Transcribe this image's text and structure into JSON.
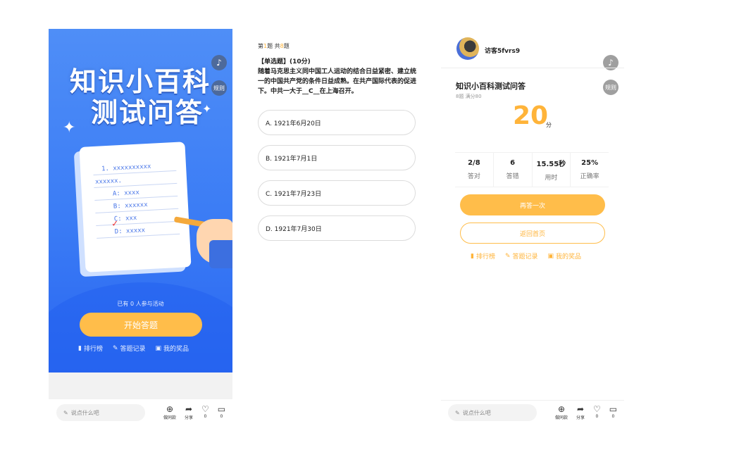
{
  "left": {
    "title_line1": "知识小百科",
    "title_line2": "测试问答",
    "rules_label": "规则",
    "paper_lines": [
      "1.  xxxxxxxxxx",
      "xxxxxx.",
      "A:  xxxx",
      "B:  xxxxxx",
      "C:  xxx",
      "D:  xxxxx"
    ],
    "participants_text": "已有 0 人参与活动",
    "start_button": "开始答题",
    "links": [
      {
        "icon": "bar-chart-icon",
        "label": "排行榜"
      },
      {
        "icon": "pencil-icon",
        "label": "答题记录"
      },
      {
        "icon": "gift-icon",
        "label": "我的奖品"
      }
    ]
  },
  "comment_bar": {
    "placeholder": "说点什么吧",
    "actions": [
      {
        "icon": "plus-circle-icon",
        "label": "做同款"
      },
      {
        "icon": "share-icon",
        "label": "分享"
      },
      {
        "icon": "thumbs-up-icon",
        "label": "0"
      },
      {
        "icon": "comment-icon",
        "label": "0"
      }
    ]
  },
  "question": {
    "count_prefix": "第",
    "current": "1",
    "count_mid": "题 共",
    "total": "8",
    "count_suffix": "题",
    "type": "【单选题】(10分)",
    "text": "随着马克思主义同中国工人运动的结合日益紧密、建立统一的中国共产党的条件日益成熟。在共产国际代表的促进下。中共一大于__C__在上海召开。",
    "options": [
      "A. 1921年6月20日",
      "B. 1921年7月1日",
      "C. 1921年7月23日",
      "D. 1921年7月30日"
    ]
  },
  "result": {
    "username": "访客5fvrs9",
    "rules_label": "规则",
    "quiz_title": "知识小百科测试问答",
    "meta": "8题  满分80",
    "score": "20",
    "score_unit": "分",
    "stats": [
      {
        "value": "2/8",
        "label": "答对"
      },
      {
        "value": "6",
        "label": "答错"
      },
      {
        "value": "15.55秒",
        "label": "用时"
      },
      {
        "value": "25%",
        "label": "正确率"
      }
    ],
    "again_button": "再答一次",
    "home_button": "返回首页",
    "links": [
      {
        "icon": "bar-chart-icon",
        "label": "排行榜"
      },
      {
        "icon": "pencil-icon",
        "label": "答题记录"
      },
      {
        "icon": "gift-icon",
        "label": "我的奖品"
      }
    ]
  },
  "colors": {
    "primary_blue": "#3b7cf5",
    "accent_orange": "#ffbd4a"
  }
}
